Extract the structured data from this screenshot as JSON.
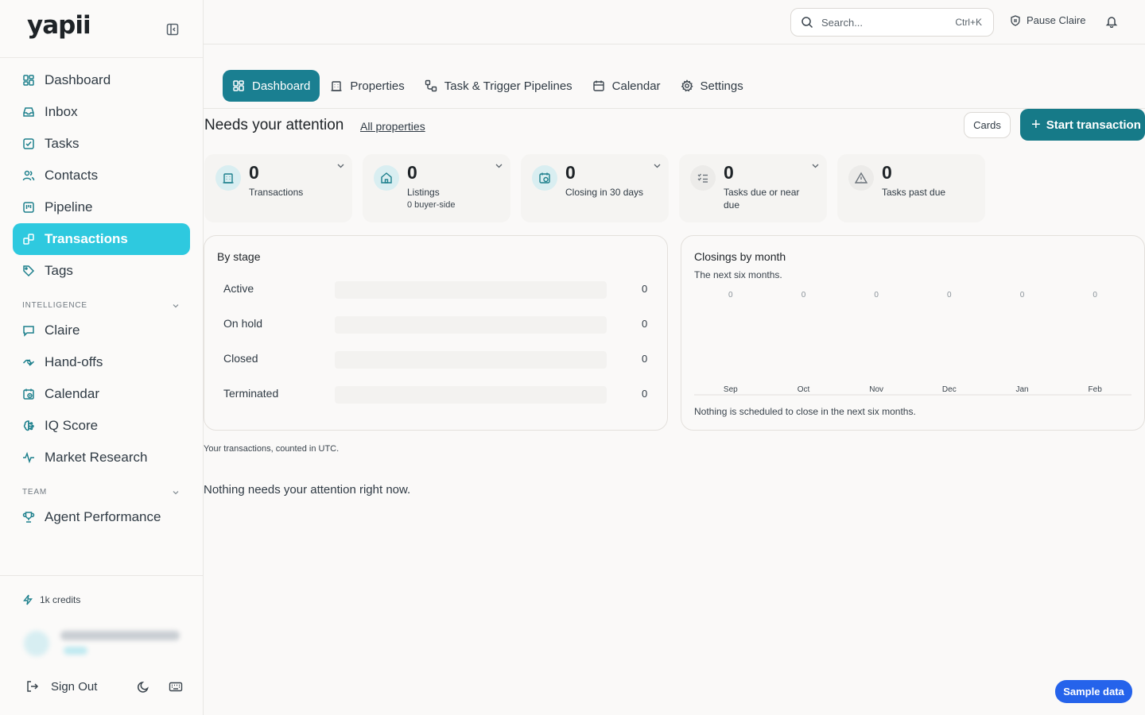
{
  "app": {
    "logo": "yapii"
  },
  "sidebar": {
    "items": [
      {
        "label": "Dashboard",
        "icon": "grid-icon"
      },
      {
        "label": "Inbox",
        "icon": "inbox-icon"
      },
      {
        "label": "Tasks",
        "icon": "checkbox-icon"
      },
      {
        "label": "Contacts",
        "icon": "users-icon"
      },
      {
        "label": "Pipeline",
        "icon": "kanban-icon"
      },
      {
        "label": "Transactions",
        "icon": "link-icon",
        "active": true
      },
      {
        "label": "Tags",
        "icon": "tag-icon"
      }
    ],
    "intelligence_label": "INTELLIGENCE",
    "intelligence_items": [
      {
        "label": "Claire",
        "icon": "chat-icon"
      },
      {
        "label": "Hand-offs",
        "icon": "handshake-icon"
      },
      {
        "label": "Calendar",
        "icon": "calendar-clock-icon"
      },
      {
        "label": "IQ Score",
        "icon": "brain-icon"
      },
      {
        "label": "Market Research",
        "icon": "activity-icon"
      }
    ],
    "team_label": "TEAM",
    "team_items": [
      {
        "label": "Agent Performance",
        "icon": "trophy-icon"
      }
    ],
    "credits": "1k credits",
    "sign_out": "Sign Out"
  },
  "topbar": {
    "search_placeholder": "Search...",
    "search_shortcut": "Ctrl+K",
    "pause_label": "Pause Claire"
  },
  "tabs": [
    {
      "label": "Dashboard",
      "active": true
    },
    {
      "label": "Properties"
    },
    {
      "label": "Task & Trigger Pipelines"
    },
    {
      "label": "Calendar"
    },
    {
      "label": "Settings"
    }
  ],
  "attention": {
    "title": "Needs your attention",
    "link": "All properties",
    "cards_button": "Cards",
    "start_button": "Start transaction"
  },
  "stats": [
    {
      "value": "0",
      "label": "Transactions",
      "sub": "",
      "icon": "building-icon",
      "color": "#d9eef1",
      "dropdown": true
    },
    {
      "value": "0",
      "label": "Listings",
      "sub": "0 buyer-side",
      "icon": "home-icon",
      "color": "#d9eef1",
      "dropdown": true
    },
    {
      "value": "0",
      "label": "Closing in 30 days",
      "sub": "",
      "icon": "calendar-icon",
      "color": "#d9eef1",
      "dropdown": true
    },
    {
      "value": "0",
      "label": "Tasks due or near due",
      "sub": "",
      "icon": "list-check-icon",
      "color": "#ecebe9",
      "dropdown": true
    },
    {
      "value": "0",
      "label": "Tasks past due",
      "sub": "",
      "icon": "warning-icon",
      "color": "#ecebe9",
      "dropdown": false
    }
  ],
  "by_stage": {
    "title": "By stage",
    "rows": [
      {
        "label": "Active",
        "value": 0
      },
      {
        "label": "On hold",
        "value": 0
      },
      {
        "label": "Closed",
        "value": 0
      },
      {
        "label": "Terminated",
        "value": 0
      }
    ]
  },
  "closings": {
    "title": "Closings by month",
    "subtitle": "The next six months.",
    "note": "Nothing is scheduled to close in the next six months."
  },
  "chart_data": {
    "type": "bar",
    "categories": [
      "Sep",
      "Oct",
      "Nov",
      "Dec",
      "Jan",
      "Feb"
    ],
    "values": [
      0,
      0,
      0,
      0,
      0,
      0
    ],
    "title": "Closings by month",
    "subtitle": "The next six months.",
    "xlabel": "",
    "ylabel": "",
    "grid": false
  },
  "footer": {
    "utc_note": "Your transactions, counted in UTC.",
    "empty": "Nothing needs your attention right now.",
    "sample_button": "Sample data"
  },
  "colors": {
    "accent": "#1a7f91",
    "active_nav": "#2ec9df",
    "sample": "#2563eb"
  }
}
